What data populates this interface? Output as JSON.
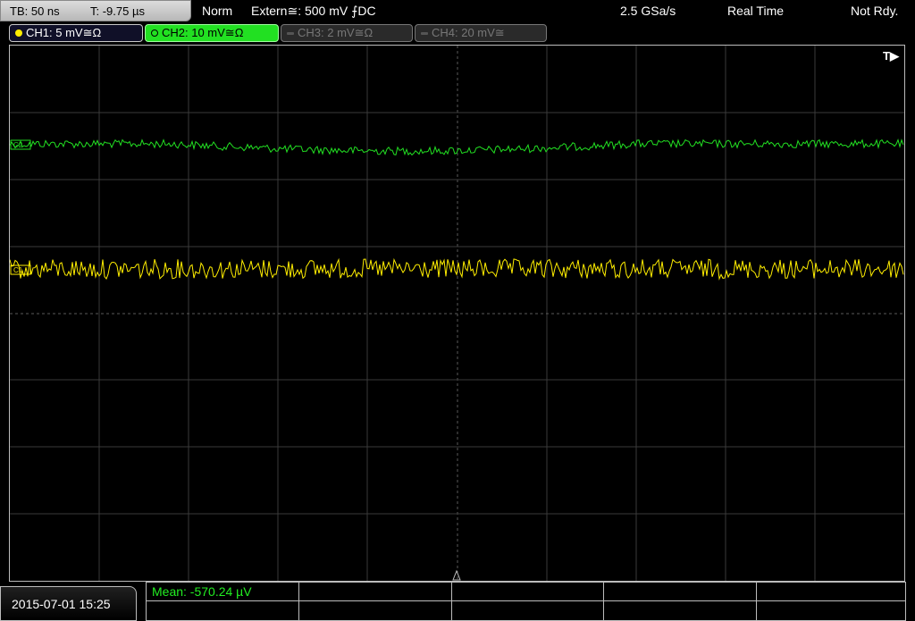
{
  "top": {
    "timebase": "TB: 50 ns",
    "trigger_time": "T: -9.75 µs",
    "mode": "Norm",
    "trigger_source": "Extern≅: 500 mV ⨍DC",
    "sample_rate": "2.5 GSa/s",
    "acq_mode": "Real Time",
    "status": "Not Rdy."
  },
  "channels": [
    {
      "label": "CH1: 5 mV≅Ω",
      "color": "#ffee00",
      "active": true
    },
    {
      "label": "CH2: 10 mV≅Ω",
      "color": "#22e022",
      "active": true
    },
    {
      "label": "CH3: 2 mV≅Ω",
      "color": "#777777",
      "active": false
    },
    {
      "label": "CH4: 20 mV≅",
      "color": "#777777",
      "active": false
    }
  ],
  "screen": {
    "trigger_marker": "T▶",
    "ch1_offset_label": "C1",
    "ch2_offset_label": "C2"
  },
  "bottom": {
    "datetime": "2015-07-01 15:25",
    "measurement": "Mean: -570.24 µV"
  }
}
